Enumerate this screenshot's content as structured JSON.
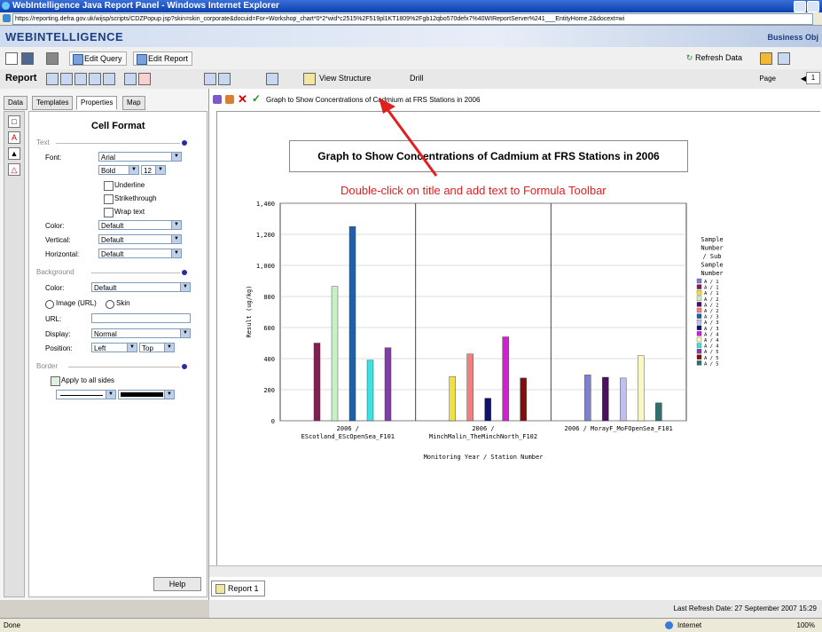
{
  "window": {
    "title": "WebIntelligence Java Report Panel - Windows Internet Explorer",
    "url": "https://reporting.defra.gov.uk/wijsp/scripts/CDZPopup.jsp?skin=skin_corporate&docuid=For+Workshop_chart*0*2*wid*c2515%2F519pl1KT1809%2Fgb12qbo570defx7%40WIReportServer%241___EntityHome.2&docext=wi"
  },
  "brand": {
    "name": "WEBINTELLIGENCE",
    "right": "Business Obj"
  },
  "toolbar": {
    "edit_query": "Edit Query",
    "edit_report": "Edit Report",
    "refresh": "Refresh Data"
  },
  "toolbar2": {
    "report": "Report",
    "view_structure": "View Structure",
    "drill": "Drill",
    "page": "Page",
    "page_num": "1"
  },
  "tabs": [
    "Data",
    "Templates",
    "Properties",
    "Map"
  ],
  "cell_format": {
    "title": "Cell Format",
    "text_section": "Text",
    "font_label": "Font:",
    "font_value": "Arial",
    "style_value": "Bold",
    "size_value": "12",
    "underline": "Underline",
    "strikethrough": "Strikethrough",
    "wrap": "Wrap text",
    "color_label": "Color:",
    "color_value": "Default",
    "vertical_label": "Vertical:",
    "vertical_value": "Default",
    "horizontal_label": "Horizontal:",
    "horizontal_value": "Default",
    "background_section": "Background",
    "bg_color_label": "Color:",
    "bg_color_value": "Default",
    "image_url": "Image (URL)",
    "skin": "Skin",
    "url_label": "URL:",
    "display_label": "Display:",
    "display_value": "Normal",
    "position_label": "Position:",
    "pos_h": "Left",
    "pos_v": "Top",
    "border_section": "Border",
    "apply_all": "Apply to all sides",
    "help": "Help"
  },
  "formula": {
    "text": "Graph to Show Concentrations of Cadmium at FRS Stations in 2006"
  },
  "annotation": "Double-click on title and add text to Formula Toolbar",
  "report_tab": "Report 1",
  "refresh_date": "Last Refresh Date: 27 September 2007 15:29",
  "ie_status": {
    "left": "Done",
    "zone": "Internet",
    "zoom": "100%"
  },
  "chart_data": {
    "type": "bar",
    "title": "Graph to Show Concentrations of Cadmium at FRS Stations in 2006",
    "xlabel": "Monitoring Year / Station Number",
    "ylabel": "Result (ug/kg)",
    "ylim": [
      0,
      1400
    ],
    "yticks": [
      "0",
      "200",
      "400",
      "600",
      "800",
      "1,000",
      "1,200",
      "1,400"
    ],
    "categories": [
      "2006 / EScotland_EScOpenSea_F101",
      "2006 / MinchMalin_TheMinchNorth_F102",
      "2006 / MorayF_MoFOpenSea_F101"
    ],
    "legend_title": "Sample Number / Sub Sample Number",
    "legend": [
      "A / 1",
      "A / 1",
      "A / 1",
      "A / 2",
      "A / 2",
      "A / 2",
      "A / 3",
      "A / 3",
      "A / 3",
      "A / 4",
      "A / 4",
      "A / 4",
      "A / 5",
      "A / 5",
      "A / 5"
    ],
    "colors": [
      "#8080d0",
      "#802050",
      "#f0e040",
      "#c8f0c8",
      "#4a1060",
      "#f08080",
      "#2060a8",
      "#c0c0f0",
      "#101070",
      "#d020d0",
      "#f8f8c0",
      "#40e0e0",
      "#8040a0",
      "#801010",
      "#307070"
    ],
    "groups": [
      [
        {
          "s": 1,
          "v": 500
        },
        {
          "s": 3,
          "v": 865
        },
        {
          "s": 6,
          "v": 1250
        },
        {
          "s": 11,
          "v": 390
        },
        {
          "s": 12,
          "v": 470
        }
      ],
      [
        {
          "s": 2,
          "v": 285
        },
        {
          "s": 5,
          "v": 430
        },
        {
          "s": 8,
          "v": 145
        },
        {
          "s": 9,
          "v": 540
        },
        {
          "s": 13,
          "v": 275
        }
      ],
      [
        {
          "s": 0,
          "v": 295
        },
        {
          "s": 4,
          "v": 280
        },
        {
          "s": 7,
          "v": 275
        },
        {
          "s": 10,
          "v": 420
        },
        {
          "s": 14,
          "v": 115
        }
      ]
    ]
  }
}
